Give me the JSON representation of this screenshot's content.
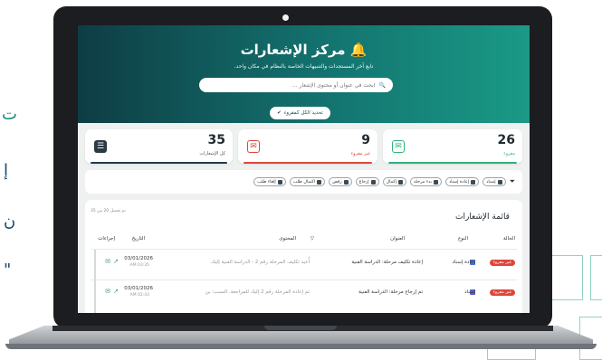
{
  "hero": {
    "title": "مركز الإشعارات",
    "subtitle": "تابع آخر المستجدات والتنبيهات الخاصة بالنظام في مكان واحد.",
    "search_placeholder": "ابحث في عنوان أو محتوى الإشعار ...",
    "mark_all_label": "تحديد الكل كمقروء"
  },
  "stats": [
    {
      "value": "35",
      "label": "كل الإشعارات",
      "color": "#1f3b4d",
      "icon": "inbox-icon"
    },
    {
      "value": "9",
      "label": "غير مقروء",
      "color": "#e0453a",
      "icon": "unread-mail-icon"
    },
    {
      "value": "26",
      "label": "مقروء",
      "color": "#2fb27a",
      "icon": "read-mail-icon"
    }
  ],
  "filters": [
    {
      "label": "إسناد"
    },
    {
      "label": "إعادة إسناد"
    },
    {
      "label": "بدء مرحلة"
    },
    {
      "label": "إكمال"
    },
    {
      "label": "إرجاع"
    },
    {
      "label": "رفض"
    },
    {
      "label": "اكتمال طلب"
    },
    {
      "label": "إلغاء طلب"
    }
  ],
  "list": {
    "title": "قائمة الإشعارات",
    "count_text": "تم تحميل 20 من 35",
    "columns": {
      "status": "الحالة",
      "type": "النوع",
      "title": "العنوان",
      "content": "المحتوى",
      "date": "التاريخ",
      "actions": "إجراءات"
    },
    "rows": [
      {
        "status": "غير مقروء",
        "type": "إعادة إسناد",
        "title": "إعادة تكليف مرحلة: الدراسة الفنية",
        "content": "أُعيد تكليف المرحلة رقم 2 - الدراسة الفنية إليك.",
        "date": "03/01/2026",
        "time": "AM 03:35"
      },
      {
        "status": "غير مقروء",
        "type": "إسناد",
        "title": "تم إرجاع مرحلة: الدراسة الفنية",
        "content": "تم إعادة المرحلة رقم 2 إليك للمراجعة. السبب: ين",
        "date": "03/01/2026",
        "time": "AM 02:43"
      }
    ]
  },
  "colors": {
    "accent": "#13736f",
    "unread": "#e0453a",
    "read": "#2fb27a"
  }
}
